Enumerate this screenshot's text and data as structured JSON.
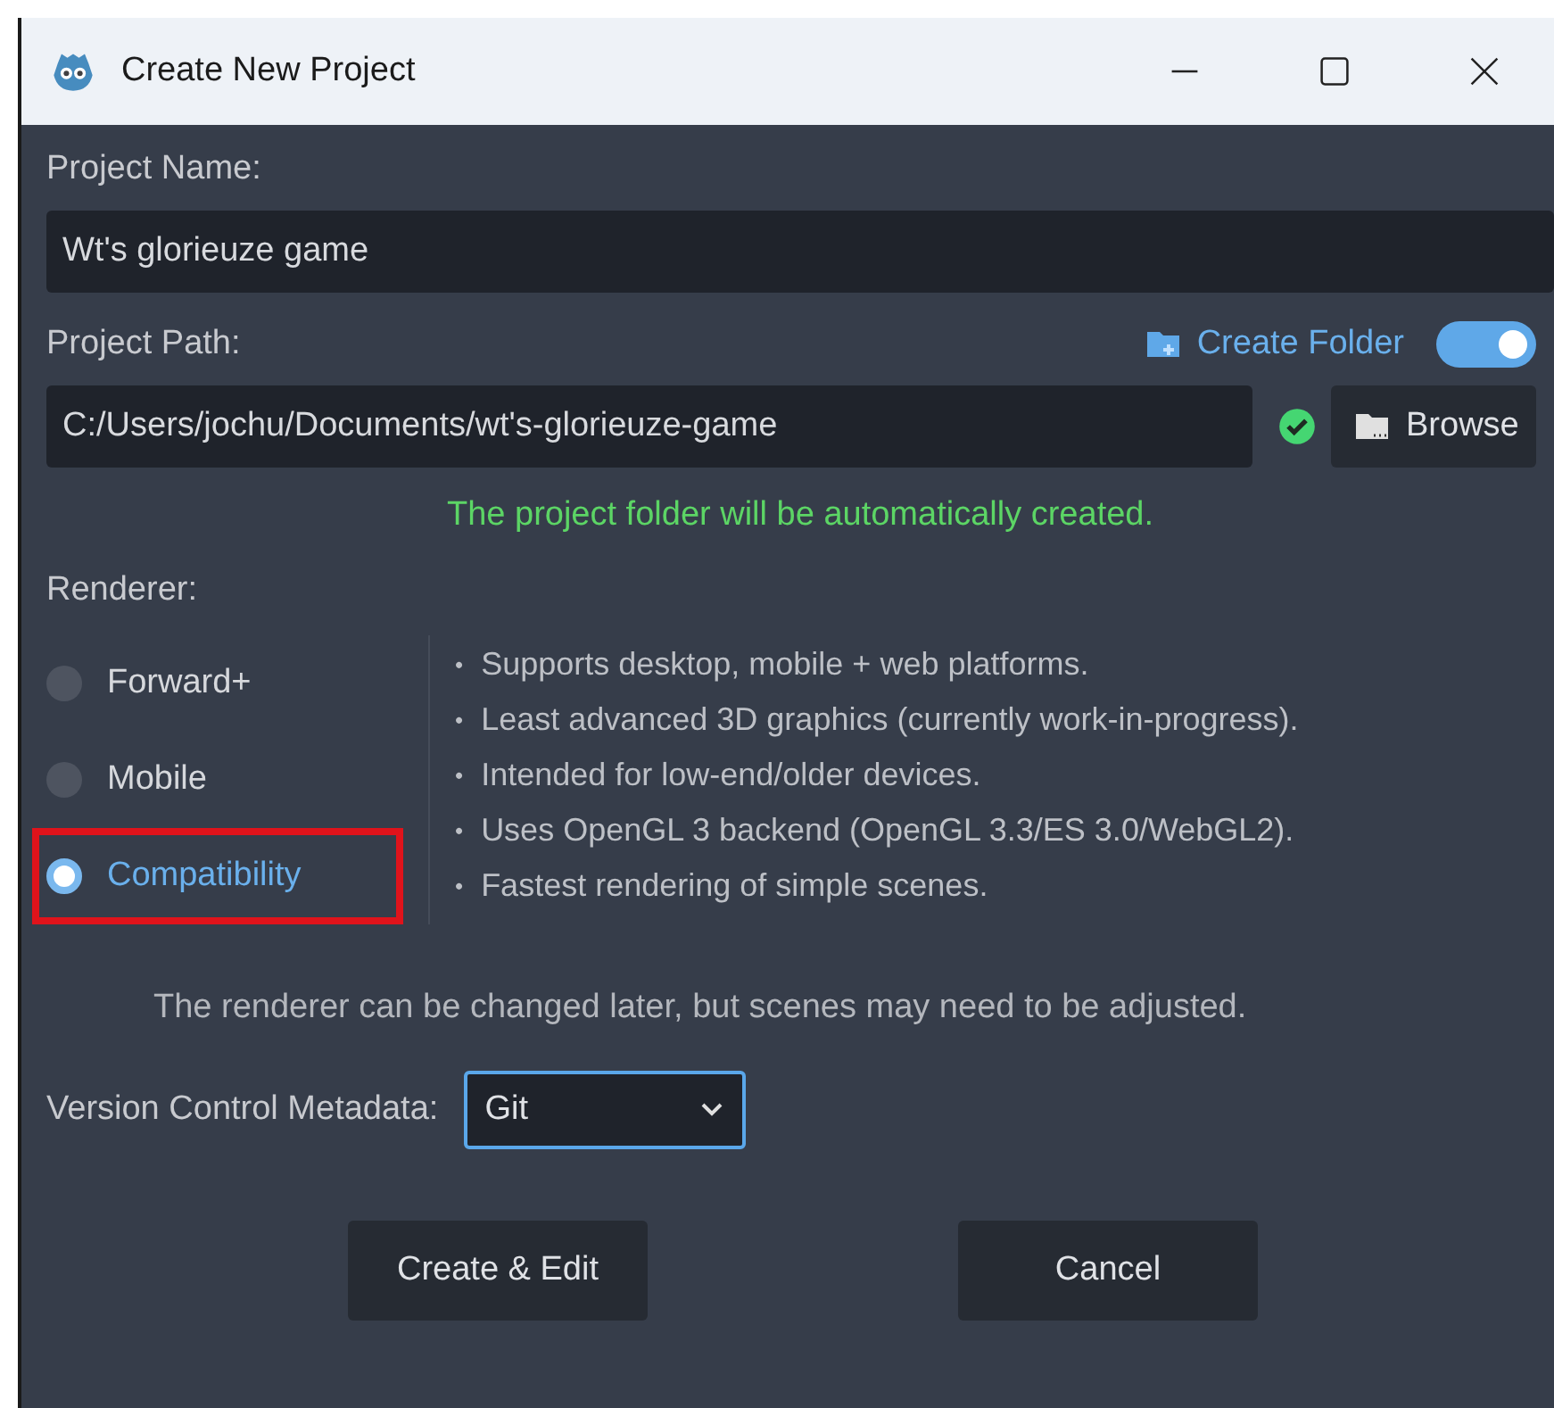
{
  "window": {
    "title": "Create New Project"
  },
  "project_name": {
    "label": "Project Name:",
    "value": "Wt's glorieuze game"
  },
  "project_path": {
    "label": "Project Path:",
    "create_folder": {
      "label": "Create Folder",
      "on": true
    },
    "value": "C:/Users/jochu/Documents/wt's-glorieuze-game",
    "valid": true,
    "browse": "Browse",
    "message": "The project folder will be automatically created."
  },
  "renderer": {
    "label": "Renderer:",
    "options": [
      {
        "label": "Forward+",
        "selected": false,
        "highlighted": false
      },
      {
        "label": "Mobile",
        "selected": false,
        "highlighted": false
      },
      {
        "label": "Compatibility",
        "selected": true,
        "highlighted": true
      }
    ],
    "details": [
      "Supports desktop, mobile + web platforms.",
      "Least advanced 3D graphics (currently work-in-progress).",
      "Intended for low-end/older devices.",
      "Uses OpenGL 3 backend (OpenGL 3.3/ES 3.0/WebGL2).",
      "Fastest rendering of simple scenes."
    ],
    "bullet": "•",
    "note": "The renderer can be changed later, but scenes may need to be adjusted."
  },
  "version_control": {
    "label": "Version Control Metadata:",
    "value": "Git"
  },
  "buttons": [
    "Create & Edit",
    "Cancel"
  ]
}
